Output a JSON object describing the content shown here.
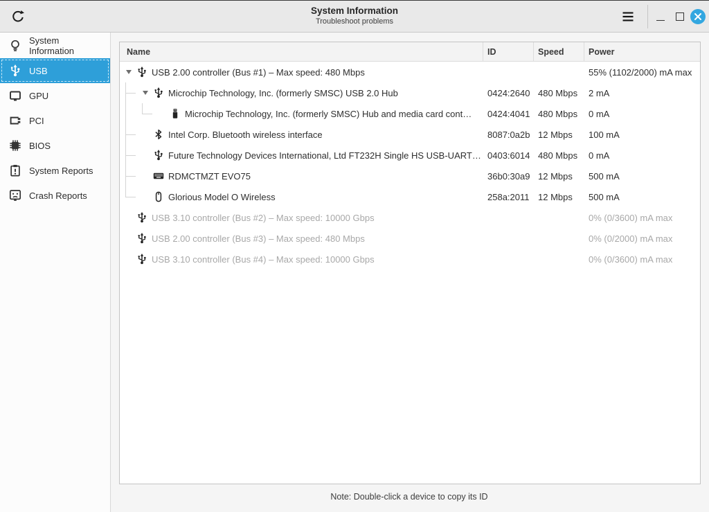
{
  "titlebar": {
    "title": "System Information",
    "subtitle": "Troubleshoot problems",
    "refresh_icon": "refresh-icon",
    "menu_icon": "hamburger-menu-icon",
    "minimize_icon": "minimize-icon",
    "maximize_icon": "maximize-icon",
    "close_icon": "close-x-icon"
  },
  "sidebar": {
    "items": [
      {
        "label": "System Information",
        "icon": "lightbulb-icon",
        "selected": false
      },
      {
        "label": "USB",
        "icon": "usb-icon",
        "selected": true
      },
      {
        "label": "GPU",
        "icon": "display-icon",
        "selected": false
      },
      {
        "label": "PCI",
        "icon": "pci-card-icon",
        "selected": false
      },
      {
        "label": "BIOS",
        "icon": "chip-icon",
        "selected": false
      },
      {
        "label": "System Reports",
        "icon": "clipboard-icon",
        "selected": false
      },
      {
        "label": "Crash Reports",
        "icon": "crash-face-icon",
        "selected": false
      }
    ]
  },
  "table": {
    "columns": [
      "Name",
      "ID",
      "Speed",
      "Power"
    ],
    "rows": [
      {
        "name": "USB 2.00 controller (Bus #1) – Max speed: 480 Mbps",
        "id": "",
        "speed": "",
        "power": "55% (1102/2000) mA max",
        "icon": "usb",
        "expander": true,
        "connectors": [],
        "dimmed": false
      },
      {
        "name": "Microchip Technology, Inc. (formerly SMSC) USB 2.0 Hub",
        "id": "0424:2640",
        "speed": "480 Mbps",
        "power": "2 mA",
        "icon": "usb",
        "expander": true,
        "connectors": [
          "t"
        ],
        "dimmed": false
      },
      {
        "name": "Microchip Technology, Inc. (formerly SMSC) Hub and media card cont…",
        "id": "0424:4041",
        "speed": "480 Mbps",
        "power": "0 mA",
        "icon": "drive",
        "expander": false,
        "connectors": [
          "v",
          "l"
        ],
        "dimmed": false
      },
      {
        "name": "Intel Corp. Bluetooth wireless interface",
        "id": "8087:0a2b",
        "speed": "12 Mbps",
        "power": "100 mA",
        "icon": "bt",
        "expander": false,
        "connectors": [
          "t"
        ],
        "dimmed": false
      },
      {
        "name": "Future Technology Devices International, Ltd FT232H Single HS USB-UART…",
        "id": "0403:6014",
        "speed": "480 Mbps",
        "power": "0 mA",
        "icon": "usb",
        "expander": false,
        "connectors": [
          "t"
        ],
        "dimmed": false
      },
      {
        "name": "RDMCTMZT EVO75",
        "id": "36b0:30a9",
        "speed": "12 Mbps",
        "power": "500 mA",
        "icon": "kbd",
        "expander": false,
        "connectors": [
          "t"
        ],
        "dimmed": false
      },
      {
        "name": "Glorious Model O Wireless",
        "id": "258a:2011",
        "speed": "12 Mbps",
        "power": "500 mA",
        "icon": "mouse",
        "expander": false,
        "connectors": [
          "l"
        ],
        "dimmed": false
      },
      {
        "name": "USB 3.10 controller (Bus #2) – Max speed: 10000 Gbps",
        "id": "",
        "speed": "",
        "power": "0% (0/3600) mA max",
        "icon": "usb",
        "expander": false,
        "connectors": [],
        "dimmed": true
      },
      {
        "name": "USB 2.00 controller (Bus #3) – Max speed: 480 Mbps",
        "id": "",
        "speed": "",
        "power": "0% (0/2000) mA max",
        "icon": "usb",
        "expander": false,
        "connectors": [],
        "dimmed": true
      },
      {
        "name": "USB 3.10 controller (Bus #4) – Max speed: 10000 Gbps",
        "id": "",
        "speed": "",
        "power": "0% (0/3600) mA max",
        "icon": "usb",
        "expander": false,
        "connectors": [],
        "dimmed": true
      }
    ],
    "row_icon_names": {
      "usb": "usb-icon",
      "drive": "flash-drive-icon",
      "bt": "bluetooth-icon",
      "kbd": "keyboard-icon",
      "mouse": "mouse-icon"
    }
  },
  "footer": {
    "note": "Note: Double-click a device to copy its ID"
  },
  "colors": {
    "accent": "#2e9fd9",
    "close_button": "#33a7e0",
    "dimmed_text": "#a8a8a8",
    "titlebar_bg": "#e9e9e9"
  }
}
